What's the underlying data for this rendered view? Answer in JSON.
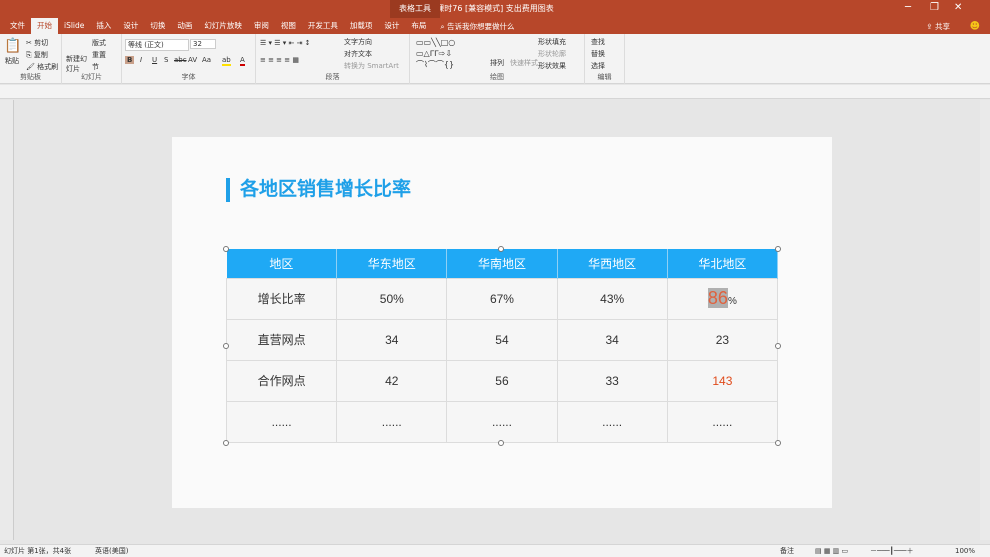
{
  "window": {
    "title": "课时76 [兼容模式] 支出费用图表",
    "context_tab": "表格工具"
  },
  "tabs": [
    "文件",
    "开始",
    "iSlide",
    "插入",
    "设计",
    "切换",
    "动画",
    "幻灯片放映",
    "审阅",
    "视图",
    "开发工具",
    "加载项",
    "设计",
    "布局"
  ],
  "search_placeholder": "告诉我你想要做什么",
  "share": "共享",
  "ribbon": {
    "clipboard": {
      "paste": "粘贴",
      "cut": "剪切",
      "copy": "复制",
      "format_painter": "格式刷",
      "label": "剪贴板"
    },
    "slides": {
      "new_slide": "新建幻灯片",
      "layout": "版式",
      "reset": "重置",
      "section": "节",
      "label": "幻灯片"
    },
    "font": {
      "font_name": "等线 (正文)",
      "font_size": "32",
      "bold": "B",
      "italic": "I",
      "underline": "U",
      "shadow": "S",
      "strike": "abc",
      "spacing": "AV",
      "case": "Aa",
      "label": "字体"
    },
    "paragraph": {
      "text_direction": "文字方向",
      "align_text": "对齐文本",
      "smartart": "转换为 SmartArt",
      "label": "段落"
    },
    "drawing": {
      "arrange": "排列",
      "quick_styles": "快速样式",
      "fill": "形状填充",
      "outline": "形状轮廓",
      "effects": "形状效果",
      "label": "绘图"
    },
    "editing": {
      "find": "查找",
      "replace": "替换",
      "select": "选择",
      "label": "编辑"
    }
  },
  "slide": {
    "heading": "各地区销售增长比率",
    "table": {
      "headers": [
        "地区",
        "华东地区",
        "华南地区",
        "华西地区",
        "华北地区"
      ],
      "rows": [
        [
          "增长比率",
          "50%",
          "67%",
          "43%",
          "86"
        ],
        [
          "直营网点",
          "34",
          "54",
          "34",
          "23"
        ],
        [
          "合作网点",
          "42",
          "56",
          "33",
          "143"
        ],
        [
          "......",
          "......",
          "......",
          "......",
          "......"
        ]
      ],
      "percent_suffix": "%"
    }
  },
  "status": {
    "slide_info": "幻灯片 第1张，共4张",
    "language": "英语(美国)",
    "notes": "备注",
    "zoom": "100%"
  },
  "colors": {
    "accent": "#1fa9f5",
    "titlebar": "#b7472a",
    "highlight_text": "#e04a1a"
  }
}
